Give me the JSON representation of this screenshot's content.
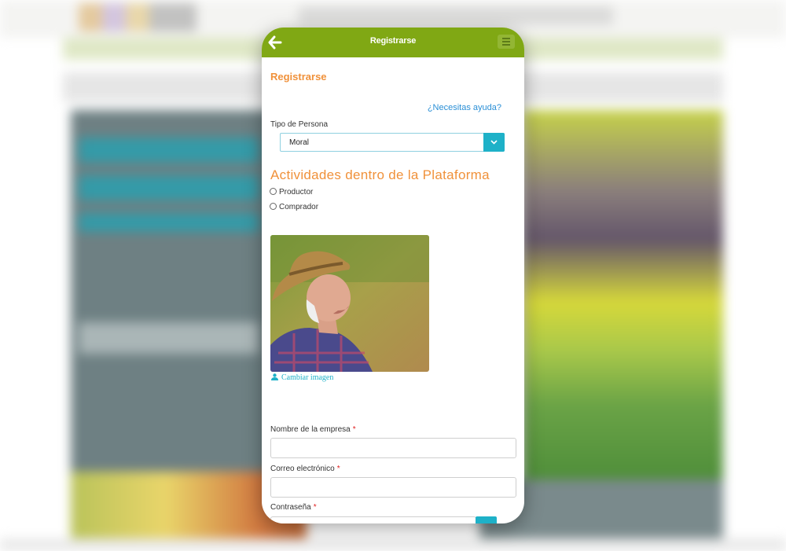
{
  "app": {
    "title": "Registrarse"
  },
  "form": {
    "heading": "Registrarse",
    "help_link": "¿Necesitas ayuda?",
    "person_type": {
      "label": "Tipo de Persona",
      "selected": "Moral"
    },
    "activities": {
      "title": "Actividades dentro de la Plataforma",
      "options": [
        "Productor",
        "Comprador"
      ]
    },
    "photo": {
      "change_label": "Cambiar imagen"
    },
    "company_name": {
      "label": "Nombre de la empresa",
      "required_mark": "*",
      "value": ""
    },
    "email": {
      "label": "Correo electrónico",
      "required_mark": "*",
      "value": ""
    },
    "password": {
      "label": "Contraseña",
      "required_mark": "*",
      "value": ""
    }
  },
  "colors": {
    "appbar": "#80a814",
    "accent_orange": "#f0913a",
    "accent_teal": "#1eb1c8",
    "link_blue": "#2a8fd6"
  },
  "icons": {
    "back": "arrow-left-icon",
    "menu": "hamburger-menu-icon",
    "dropdown": "chevron-down-icon",
    "upload": "user-upload-icon",
    "visibility": "eye-icon"
  }
}
